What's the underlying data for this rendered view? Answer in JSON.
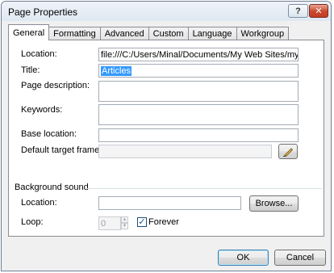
{
  "window": {
    "title": "Page Properties",
    "help_glyph": "?",
    "close_glyph": "✕"
  },
  "tabs": [
    {
      "label": "General",
      "active": true
    },
    {
      "label": "Formatting"
    },
    {
      "label": "Advanced"
    },
    {
      "label": "Custom"
    },
    {
      "label": "Language"
    },
    {
      "label": "Workgroup"
    }
  ],
  "general": {
    "location_label": "Location:",
    "location_value": "file:///C:/Users/Minal/Documents/My Web Sites/mysite/artic",
    "title_label": "Title:",
    "title_value": "Articles",
    "page_description_label": "Page description:",
    "page_description_value": "",
    "keywords_label": "Keywords:",
    "keywords_value": "",
    "base_location_label": "Base location:",
    "base_location_value": "",
    "default_target_frame_label": "Default target frame:",
    "default_target_frame_value": "",
    "pencil_icon": "pencil-icon"
  },
  "background_sound": {
    "section_label": "Background sound",
    "location_label": "Location:",
    "location_value": "",
    "browse_label": "Browse...",
    "loop_label": "Loop:",
    "loop_value": "0",
    "forever_label": "Forever",
    "forever_checked": true
  },
  "footer": {
    "ok_label": "OK",
    "cancel_label": "Cancel"
  }
}
